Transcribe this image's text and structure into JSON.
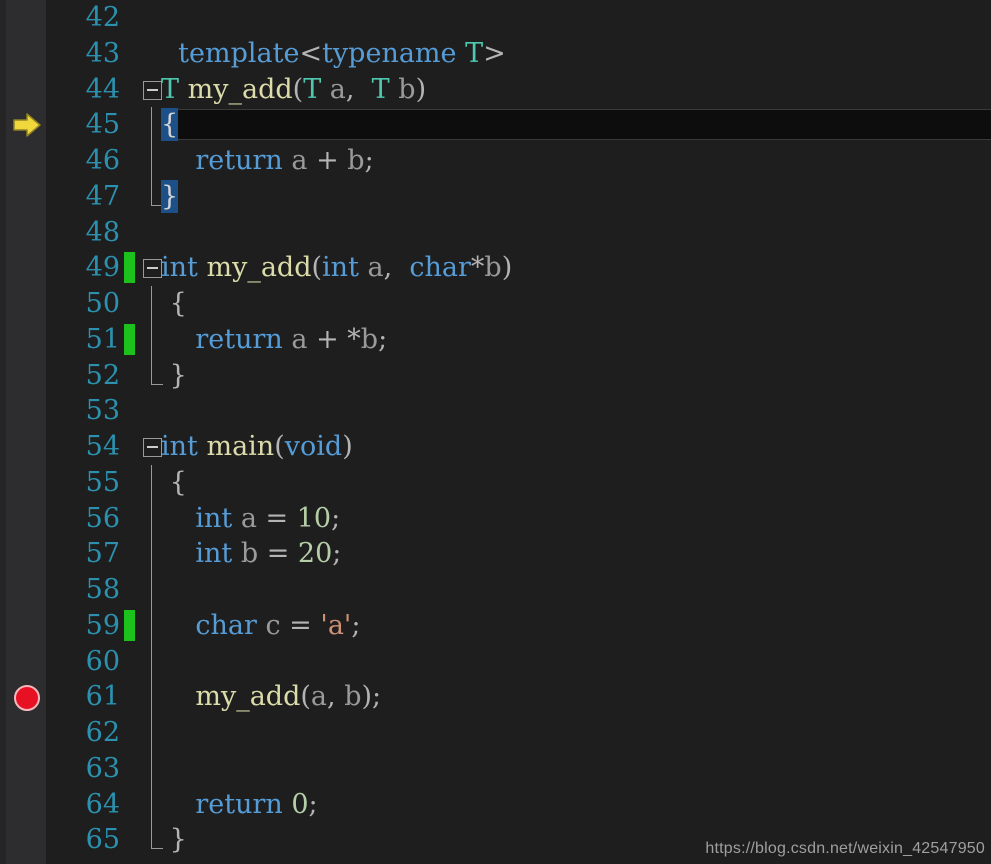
{
  "editor": {
    "watermark": "https://blog.csdn.net/weixin_42547950",
    "first_line": 42,
    "last_line": 65,
    "colors": {
      "background": "#1e1e1e",
      "gutter": "#2d2d30",
      "linenumber": "#2b91af",
      "keyword": "#569cd6",
      "type": "#4ec9b0",
      "function": "#dcdcaa",
      "identifier": "#9a9a9a",
      "number": "#b5cea8",
      "string": "#ce9178",
      "changebar": "#1cc11c",
      "breakpoint": "#e81123",
      "exec_arrow": "#ecd857",
      "brace_match": "#1d5089",
      "current_line": "#0d0d0d"
    }
  },
  "lines": [
    {
      "n": "42",
      "text": ""
    },
    {
      "n": "43",
      "text": "  template<typename T>"
    },
    {
      "n": "44",
      "text": "T my_add(T a,  T b)"
    },
    {
      "n": "45",
      "text": "{"
    },
    {
      "n": "46",
      "text": "    return a + b;"
    },
    {
      "n": "47",
      "text": "}"
    },
    {
      "n": "48",
      "text": ""
    },
    {
      "n": "49",
      "text": "int my_add(int a,  char*b)"
    },
    {
      "n": "50",
      "text": " {"
    },
    {
      "n": "51",
      "text": "    return a + *b;"
    },
    {
      "n": "52",
      "text": " }"
    },
    {
      "n": "53",
      "text": ""
    },
    {
      "n": "54",
      "text": "int main(void)"
    },
    {
      "n": "55",
      "text": " {"
    },
    {
      "n": "56",
      "text": "    int a = 10;"
    },
    {
      "n": "57",
      "text": "    int b = 20;"
    },
    {
      "n": "58",
      "text": ""
    },
    {
      "n": "59",
      "text": "    char c = 'a';"
    },
    {
      "n": "60",
      "text": ""
    },
    {
      "n": "61",
      "text": "    my_add(a, b);"
    },
    {
      "n": "62",
      "text": ""
    },
    {
      "n": "63",
      "text": ""
    },
    {
      "n": "64",
      "text": "    return 0;"
    },
    {
      "n": "65",
      "text": " }"
    }
  ],
  "markers": {
    "exec_arrow_line": "45",
    "breakpoint_line": "61",
    "changed_lines": [
      "49",
      "51",
      "59"
    ],
    "collapse_lines": [
      "44",
      "49",
      "54"
    ],
    "current_line": "45",
    "matched_braces": [
      "45",
      "47"
    ]
  }
}
